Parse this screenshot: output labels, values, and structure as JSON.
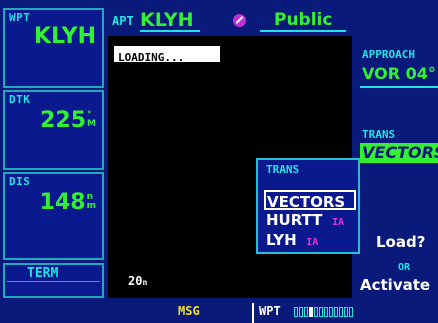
{
  "header": {
    "page_tag": "APT",
    "identifier": "KLYH",
    "type": "Public"
  },
  "left": {
    "wpt": {
      "label": "WPT",
      "value": "KLYH"
    },
    "dtk": {
      "label": "DTK",
      "value": "225",
      "unit_top": "°",
      "unit_bottom": "M"
    },
    "dis": {
      "label": "DIS",
      "value": "148",
      "unit_top": "n",
      "unit_bottom": "m"
    },
    "term_label": "TERM"
  },
  "map": {
    "status": "LOADING...",
    "zoom": "20",
    "zoom_unit": "n"
  },
  "right": {
    "approach_label": "APPROACH",
    "approach_value": "VOR 04°",
    "trans_label": "TRANS",
    "trans_value": "VECTORS",
    "load": "Load?",
    "or": "OR",
    "activate": "Activate"
  },
  "popup": {
    "title": "TRANS",
    "items": [
      {
        "name": "VECTORS",
        "suffix": ""
      },
      {
        "name": "HURTT",
        "suffix": "IA"
      },
      {
        "name": "LYH",
        "suffix": "IA"
      }
    ]
  },
  "footer": {
    "msg": "MSG",
    "wpt": "WPT",
    "page_count": 12,
    "active_page_index": 3
  },
  "colors": {
    "background": "#0a1a7a",
    "cyan": "#22e3e3",
    "green": "#33f033",
    "magenta": "#e030e0",
    "msg_yellow": "#f0e020"
  }
}
